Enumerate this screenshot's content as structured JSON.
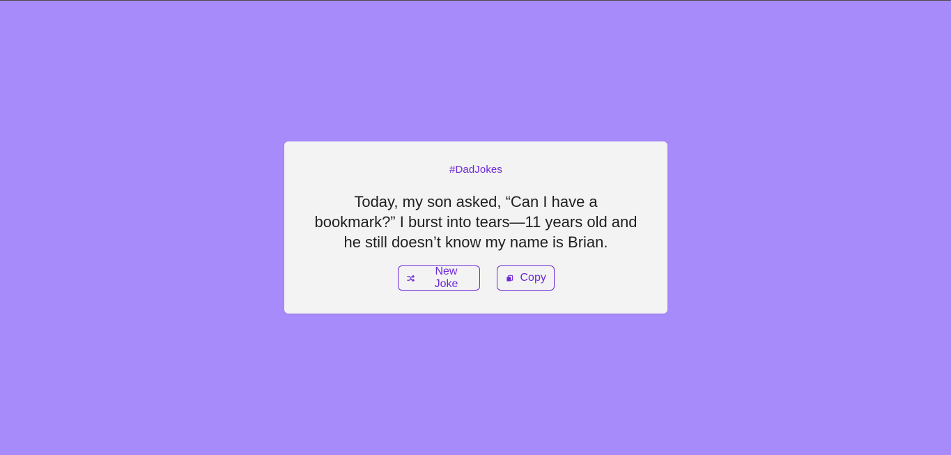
{
  "page": {
    "background": "#a78bfa",
    "accent": "#6d28d9"
  },
  "card": {
    "hashtag": "#DadJokes",
    "joke": "Today, my son asked, “Can I have a bookmark?” I burst into tears—11 years old and he still doesn’t know my name is Brian."
  },
  "actions": {
    "new_joke": {
      "label": "New Joke",
      "icon": "shuffle-icon"
    },
    "copy": {
      "label": "Copy",
      "icon": "copy-icon"
    }
  }
}
